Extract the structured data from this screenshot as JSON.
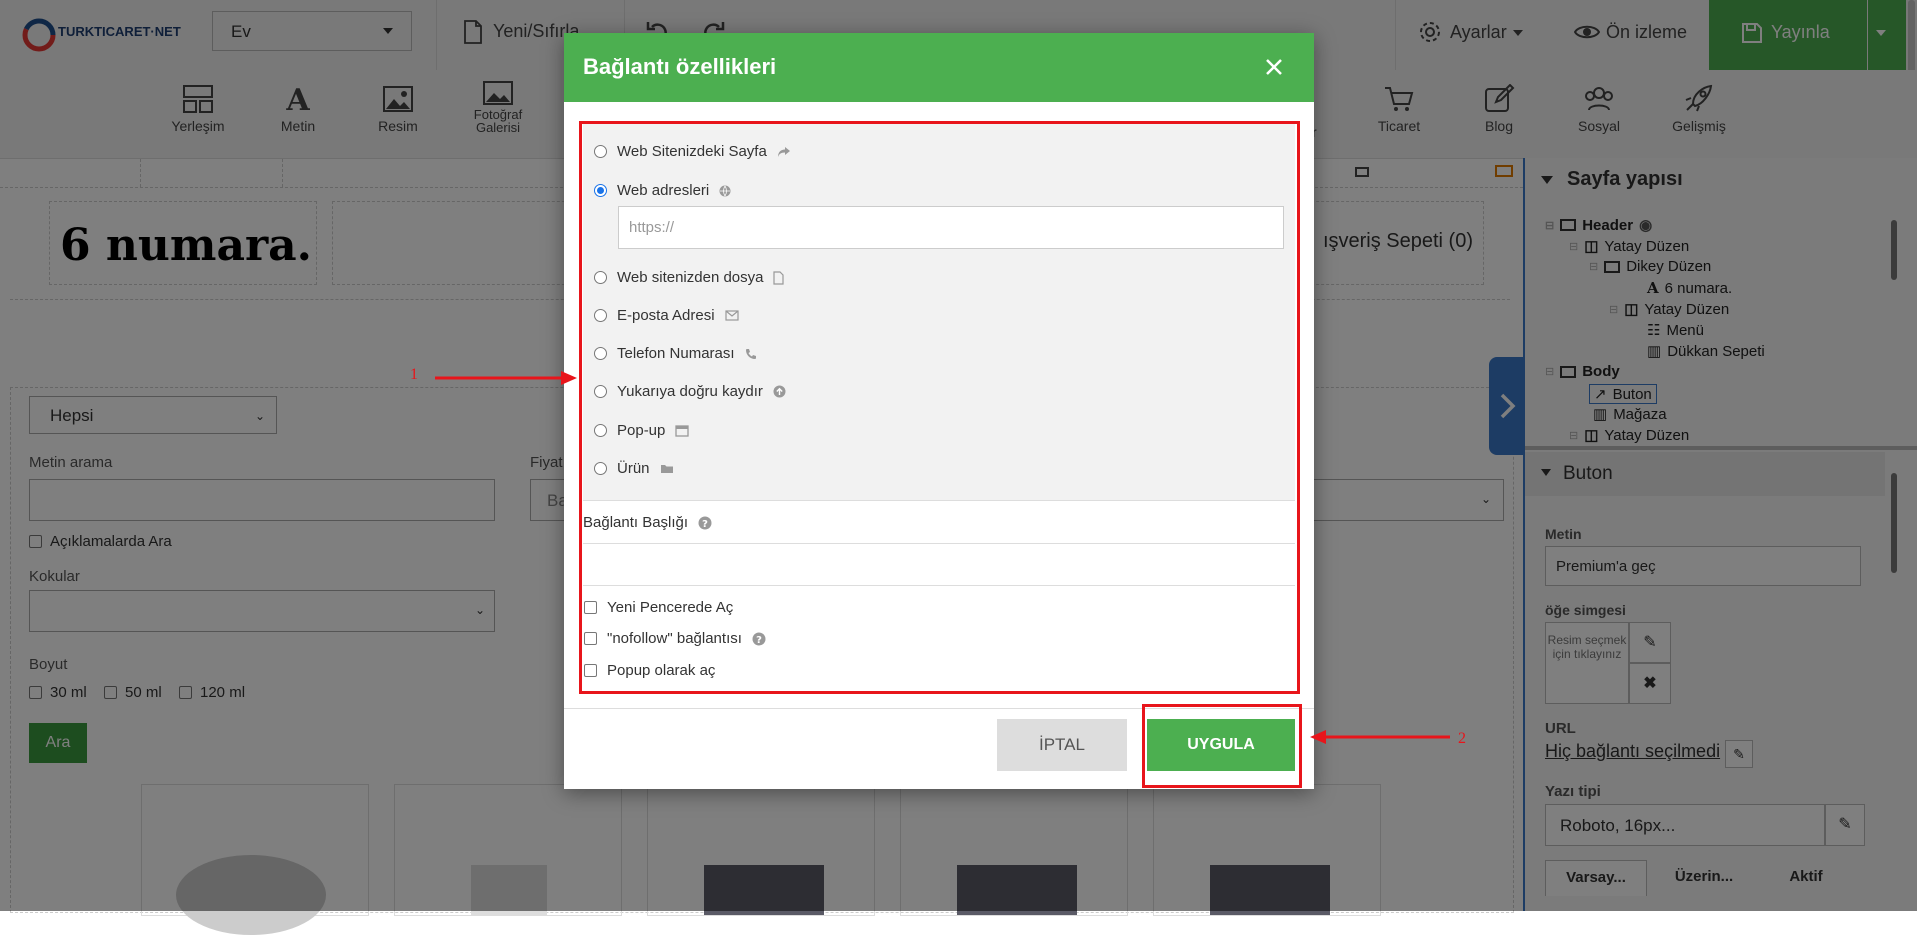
{
  "topbar": {
    "brand": "TURKTICARET·NET",
    "page_select": "Ev",
    "new_reset": "Yeni/Sıfırla",
    "settings": "Ayarlar",
    "preview": "Ön izleme",
    "publish": "Yayınla"
  },
  "toolbar": {
    "items_left": [
      "Yerleşim",
      "Metin",
      "Resim"
    ],
    "gallery_line1": "Fotoğraf",
    "gallery_line2": "Galerisi",
    "items_right": [
      "Ticaret",
      "Blog",
      "Sosyal",
      "Gelişmiş"
    ],
    "partial_letter": "r"
  },
  "canvas": {
    "logo_text": "6 numara.",
    "cart_text": "ışveriş Sepeti (0)",
    "filter_select": "Hepsi",
    "search_label": "Metin arama",
    "price_label": "Fiyat",
    "price_partial": "Ba",
    "desc_search": "Açıklamalarda Ara",
    "scents_label": "Kokular",
    "size_label": "Boyut",
    "sizes": [
      "30 ml",
      "50 ml",
      "120 ml"
    ],
    "search_button": "Ara"
  },
  "right_panel": {
    "structure_title": "Sayfa yapısı",
    "tree": [
      "Header",
      "Yatay Düzen",
      "Dikey Düzen",
      "6 numara.",
      "Yatay Düzen",
      "Menü",
      "Dükkan Sepeti",
      "Body",
      "Buton",
      "Mağaza",
      "Yatay Düzen"
    ],
    "buton_title": "Buton",
    "metin_label": "Metin",
    "metin_value": "Premium'a geç",
    "icon_label": "öğe simgesi",
    "icon_placeholder": "Resim seçmek için tıklayınız",
    "url_label": "URL",
    "url_value": "Hiç bağlantı seçilmedi",
    "font_label": "Yazı tipi",
    "font_value": "Roboto, 16px...",
    "tabs": [
      "Varsay...",
      "Üzerin...",
      "Aktif"
    ]
  },
  "modal": {
    "title": "Bağlantı özellikleri",
    "options": [
      {
        "label": "Web Sitenizdeki Sayfa",
        "checked": false,
        "icon": "share-icon"
      },
      {
        "label": "Web adresleri",
        "checked": true,
        "icon": "globe-icon"
      },
      {
        "label": "Web sitenizden dosya",
        "checked": false,
        "icon": "file-icon"
      },
      {
        "label": "E-posta Adresi",
        "checked": false,
        "icon": "envelope-icon"
      },
      {
        "label": "Telefon Numarası",
        "checked": false,
        "icon": "phone-icon"
      },
      {
        "label": "Yukarıya doğru kaydır",
        "checked": false,
        "icon": "arrow-up-circle-icon"
      },
      {
        "label": "Pop-up",
        "checked": false,
        "icon": "window-icon"
      },
      {
        "label": "Ürün",
        "checked": false,
        "icon": "folder-icon"
      }
    ],
    "url_placeholder": "https://",
    "link_title_label": "Bağlantı Başlığı",
    "link_title_value": "",
    "checkboxes": [
      "Yeni Pencerede Aç",
      "\"nofollow\" bağlantısı",
      "Popup olarak aç"
    ],
    "cancel": "İPTAL",
    "apply": "UYGULA"
  },
  "annotations": {
    "marker1": "1",
    "marker2": "2"
  },
  "colors": {
    "green": "#4caf50",
    "annotation_red": "#e8151b",
    "link_blue": "#1a73e8"
  }
}
